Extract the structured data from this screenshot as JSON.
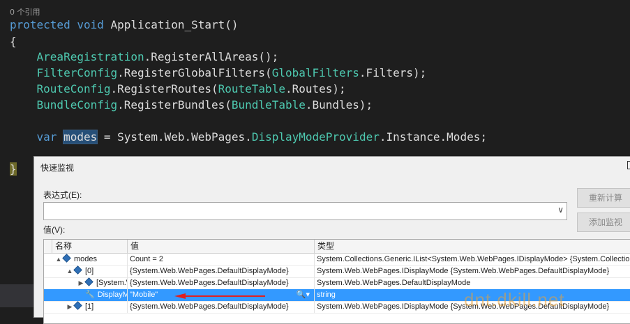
{
  "editor": {
    "ref_count": "0 个引用",
    "lines": [
      [
        {
          "t": "protected",
          "c": "kw"
        },
        {
          "t": " "
        },
        {
          "t": "void",
          "c": "kw"
        },
        {
          "t": " Application_Start()"
        }
      ],
      [
        {
          "t": "{"
        }
      ],
      [
        {
          "t": "    "
        },
        {
          "t": "AreaRegistration",
          "c": "ty"
        },
        {
          "t": ".RegisterAllAreas();"
        }
      ],
      [
        {
          "t": "    "
        },
        {
          "t": "FilterConfig",
          "c": "ty"
        },
        {
          "t": ".RegisterGlobalFilters("
        },
        {
          "t": "GlobalFilters",
          "c": "ty"
        },
        {
          "t": ".Filters);"
        }
      ],
      [
        {
          "t": "    "
        },
        {
          "t": "RouteConfig",
          "c": "ty"
        },
        {
          "t": ".RegisterRoutes("
        },
        {
          "t": "RouteTable",
          "c": "ty"
        },
        {
          "t": ".Routes);"
        }
      ],
      [
        {
          "t": "    "
        },
        {
          "t": "BundleConfig",
          "c": "ty"
        },
        {
          "t": ".RegisterBundles("
        },
        {
          "t": "BundleTable",
          "c": "ty"
        },
        {
          "t": ".Bundles);"
        }
      ],
      [
        {
          "t": ""
        }
      ],
      [
        {
          "t": "    "
        },
        {
          "t": "var",
          "c": "kw"
        },
        {
          "t": " "
        },
        {
          "t": "modes",
          "c": "hl"
        },
        {
          "t": " = System.Web.WebPages."
        },
        {
          "t": "DisplayModeProvider",
          "c": "ty"
        },
        {
          "t": ".Instance.Modes;"
        }
      ],
      [
        {
          "t": ""
        }
      ],
      [
        {
          "t": "}",
          "c": "brace-hl"
        }
      ]
    ]
  },
  "dialog": {
    "title": "快速监视",
    "expression_label": "表达式(E):",
    "expression_value": "",
    "reevaluate_button": "重新计算",
    "add_watch_button": "添加监视",
    "value_label": "值(V):",
    "columns": {
      "name": "名称",
      "value": "值",
      "type": "类型"
    },
    "rows": [
      {
        "indent": 0,
        "expander": "▲",
        "icon": "cube",
        "name": "modes",
        "value": "Count = 2",
        "type": "System.Collections.Generic.IList<System.Web.WebPages.IDisplayMode> {System.Collections.Generic.List<System.Web.WebPages.IDisplayMode>}"
      },
      {
        "indent": 1,
        "expander": "▲",
        "icon": "cube",
        "name": "[0]",
        "value": "{System.Web.WebPages.DefaultDisplayMode}",
        "type": "System.Web.WebPages.IDisplayMode {System.Web.WebPages.DefaultDisplayMode}"
      },
      {
        "indent": 2,
        "expander": "▶",
        "icon": "cube",
        "name": "[System.Web.WebPages.DefaultDisplayMode]",
        "value": "{System.Web.WebPages.DefaultDisplayMode}",
        "type": "System.Web.WebPages.DefaultDisplayMode"
      },
      {
        "indent": 2,
        "expander": "",
        "icon": "wrench",
        "name": "DisplayModeId",
        "value": "\"Mobile\"",
        "type": "string",
        "selected": true
      },
      {
        "indent": 1,
        "expander": "▶",
        "icon": "cube",
        "name": "[1]",
        "value": "{System.Web.WebPages.DefaultDisplayMode}",
        "type": "System.Web.WebPages.IDisplayMode {System.Web.WebPages.DefaultDisplayMode}"
      }
    ]
  },
  "watermark": "dnt.dkill.net",
  "colors": {
    "editor_bg": "#1e1e1e",
    "keyword": "#569cd6",
    "type": "#4ec9b0",
    "selection": "#3399ff",
    "arrow": "#e02020"
  }
}
